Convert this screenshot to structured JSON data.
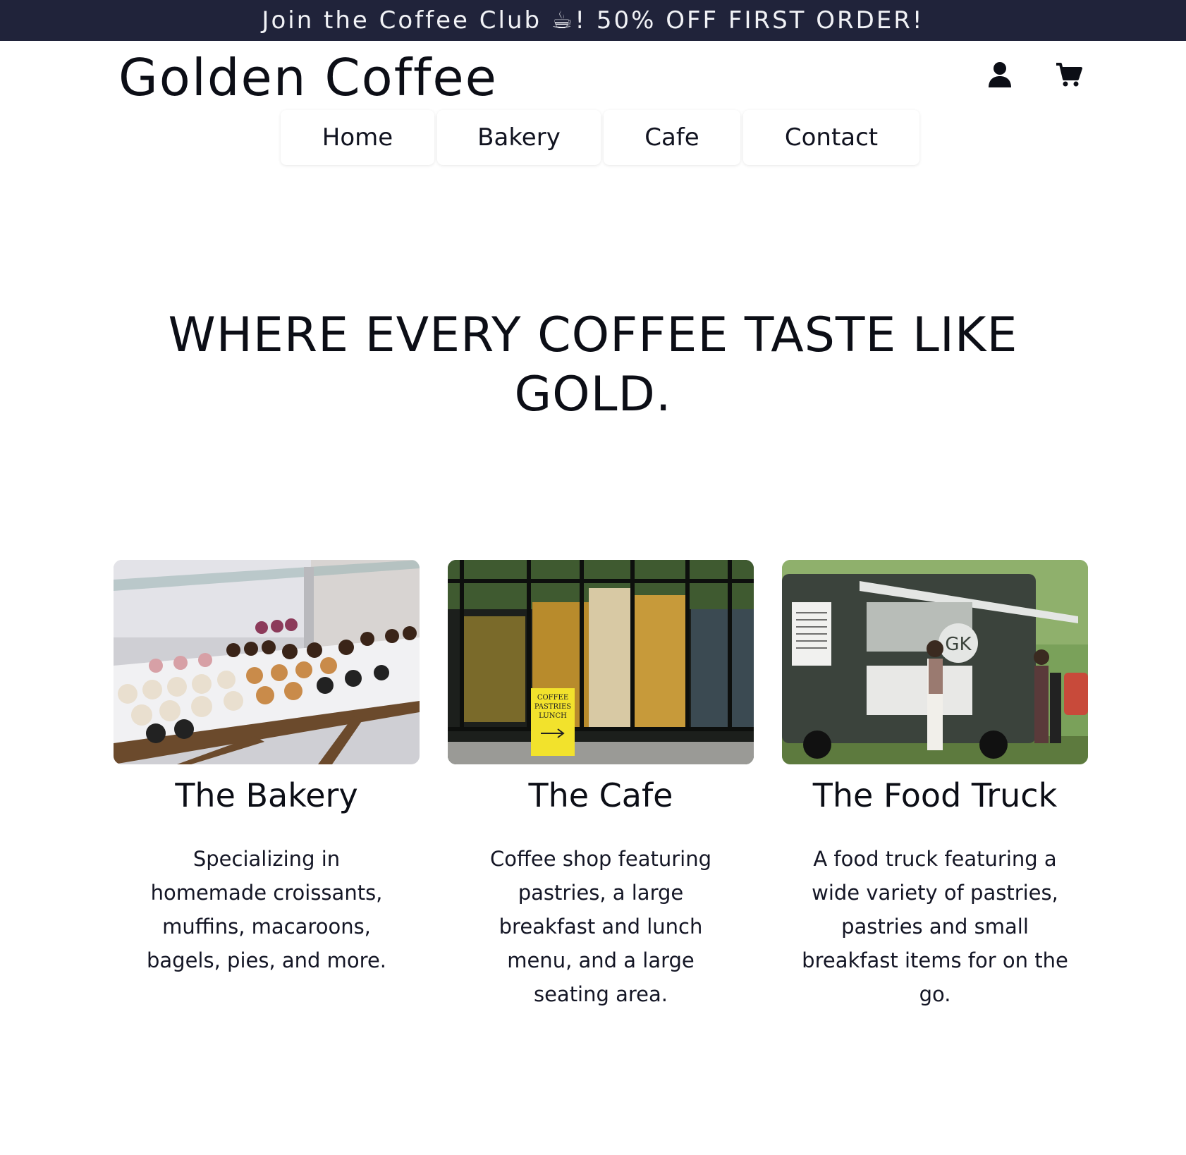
{
  "promo": {
    "text": "Join the Coffee Club ☕! 50% OFF FIRST ORDER!"
  },
  "header": {
    "logo": "Golden Coffee",
    "icons": {
      "account": "user-icon",
      "cart": "cart-icon"
    }
  },
  "nav": {
    "items": [
      {
        "label": "Home"
      },
      {
        "label": "Bakery"
      },
      {
        "label": "Cafe"
      },
      {
        "label": "Contact"
      }
    ]
  },
  "hero": {
    "title": "WHERE EVERY COFFEE TASTE LIKE GOLD."
  },
  "cards": [
    {
      "title": "The Bakery",
      "description": "Specializing in homemade croissants, muffins, macaroons, bagels, pies, and more."
    },
    {
      "title": "The Cafe",
      "description": "Coffee shop featuring pastries, a large breakfast and lunch menu, and a large seating area.",
      "sign_text": [
        "COFFEE",
        "PASTRIES",
        "LUNCH"
      ]
    },
    {
      "title": "The Food Truck",
      "description": "A food truck featuring a wide variety of pastries, pastries and small breakfast items for on the go.",
      "truck_logo": "GK"
    }
  ],
  "colors": {
    "promo_bg": "#20233a",
    "text": "#111320",
    "sign_yellow": "#f2e22c"
  }
}
